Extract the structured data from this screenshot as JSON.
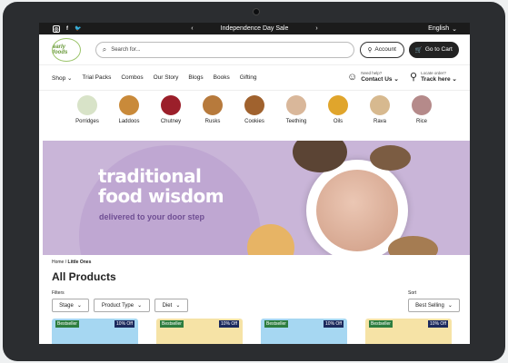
{
  "topbar": {
    "promo": "Independence Day Sale",
    "prev_arrow": "‹",
    "next_arrow": "›",
    "language": "English"
  },
  "header": {
    "logo_text": "early foods",
    "search_placeholder": "Search for...",
    "account_label": "Account",
    "cart_label": "Go to Cart"
  },
  "nav": {
    "items": [
      "Shop",
      "Trial Packs",
      "Combos",
      "Our Story",
      "Blogs",
      "Books",
      "Gifting"
    ],
    "help_small": "Need help?",
    "help_big": "Contact Us",
    "track_small": "Locate order?",
    "track_big": "Track here"
  },
  "categories": [
    {
      "label": "Porridges",
      "color": "#d8e3c8"
    },
    {
      "label": "Laddoos",
      "color": "#c98a3a"
    },
    {
      "label": "Chutney",
      "color": "#9b1f2a"
    },
    {
      "label": "Rusks",
      "color": "#b77a3c"
    },
    {
      "label": "Cookies",
      "color": "#a0622e"
    },
    {
      "label": "Teething",
      "color": "#d9b79a"
    },
    {
      "label": "Oils",
      "color": "#e0a52c"
    },
    {
      "label": "Rava",
      "color": "#d7b98f"
    },
    {
      "label": "Rice",
      "color": "#b58a8a"
    }
  ],
  "hero": {
    "line1": "traditional",
    "line2": "food wisdom",
    "sub": "delivered to your door step"
  },
  "breadcrumb": {
    "home": "Home",
    "sep": "/",
    "current": "Little Ones"
  },
  "page_title": "All Products",
  "filters": {
    "label": "Filters",
    "options": [
      "Stage",
      "Product Type",
      "Diet"
    ],
    "sort_label": "Sort",
    "sort_value": "Best Selling"
  },
  "cards": [
    {
      "badge": "Bestseller",
      "discount": "10% Off",
      "bg": "#a6d7f2"
    },
    {
      "badge": "Bestseller",
      "discount": "10% Off",
      "bg": "#f6e3a6"
    },
    {
      "badge": "Bestseller",
      "discount": "10% Off",
      "bg": "#a6d7f2"
    },
    {
      "badge": "Bestseller",
      "discount": "10% Off",
      "bg": "#f6e3a6"
    }
  ]
}
